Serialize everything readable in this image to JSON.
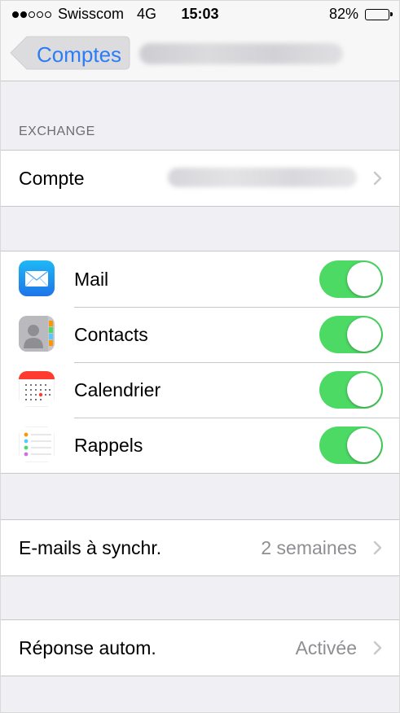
{
  "status_bar": {
    "carrier": "Swisscom",
    "network": "4G",
    "time": "15:03",
    "battery": "82%",
    "battery_level": 0.82
  },
  "nav": {
    "back_label": "Comptes"
  },
  "exchange_section": {
    "header": "EXCHANGE",
    "account_label": "Compte"
  },
  "services": [
    {
      "label": "Mail",
      "icon": "mail-icon",
      "enabled": true
    },
    {
      "label": "Contacts",
      "icon": "contacts-icon",
      "enabled": true
    },
    {
      "label": "Calendrier",
      "icon": "calendar-icon",
      "enabled": true
    },
    {
      "label": "Rappels",
      "icon": "reminders-icon",
      "enabled": true
    }
  ],
  "mail_sync": {
    "label": "E-mails à synchr.",
    "value": "2 semaines"
  },
  "auto_reply": {
    "label": "Réponse autom.",
    "value": "Activée"
  },
  "colors": {
    "accent": "#2b7cf6",
    "toggle_on": "#4cd964",
    "group_bg": "#efeff4",
    "secondary_text": "#8e8e93"
  }
}
